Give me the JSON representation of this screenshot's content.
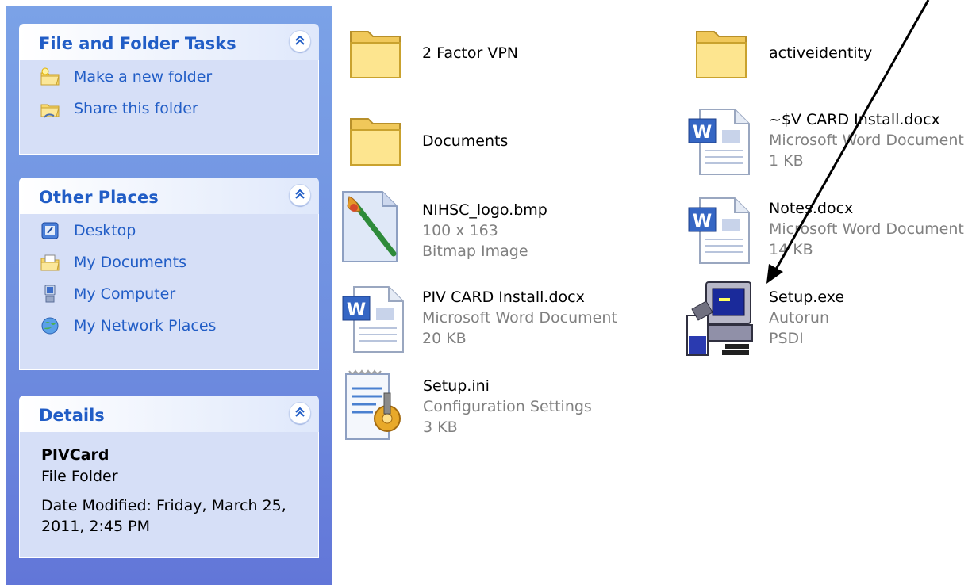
{
  "task_pane": {
    "file_folder_tasks": {
      "title": "File and Folder Tasks",
      "items": [
        {
          "label": "Make a new folder",
          "icon": "new-folder-icon"
        },
        {
          "label": "Share this folder",
          "icon": "share-folder-icon"
        }
      ]
    },
    "other_places": {
      "title": "Other Places",
      "items": [
        {
          "label": "Desktop",
          "icon": "desktop-icon"
        },
        {
          "label": "My Documents",
          "icon": "my-documents-icon"
        },
        {
          "label": "My Computer",
          "icon": "my-computer-icon"
        },
        {
          "label": "My Network Places",
          "icon": "network-places-icon"
        }
      ]
    },
    "details": {
      "title": "Details",
      "name": "PIVCard",
      "type": "File Folder",
      "date_modified": "Date Modified: Friday, March 25, 2011, 2:45 PM"
    }
  },
  "files": [
    {
      "name": "2 Factor VPN",
      "lines": [],
      "icon": "folder-icon"
    },
    {
      "name": "activeidentity",
      "lines": [],
      "icon": "folder-icon"
    },
    {
      "name": "Documents",
      "lines": [],
      "icon": "folder-icon"
    },
    {
      "name": "~$V CARD Install.docx",
      "lines": [
        "Microsoft Word Document",
        "1 KB"
      ],
      "icon": "word-document-icon"
    },
    {
      "name": "NIHSC_logo.bmp",
      "lines": [
        "100 x 163",
        "Bitmap Image"
      ],
      "icon": "bitmap-image-icon"
    },
    {
      "name": "Notes.docx",
      "lines": [
        "Microsoft Word Document",
        "14 KB"
      ],
      "icon": "word-document-icon"
    },
    {
      "name": "PIV CARD Install.docx",
      "lines": [
        "Microsoft Word Document",
        "20 KB"
      ],
      "icon": "word-document-icon"
    },
    {
      "name": "Setup.exe",
      "lines": [
        "Autorun",
        "PSDI"
      ],
      "icon": "setup-exe-icon"
    },
    {
      "name": "Setup.ini",
      "lines": [
        "Configuration Settings",
        "3 KB"
      ],
      "icon": "config-settings-icon"
    }
  ],
  "colors": {
    "task_link": "#215dc6",
    "pane_blue": "#6f8fe0",
    "panel_body": "#d6dff7",
    "secondary_text": "#808080"
  }
}
